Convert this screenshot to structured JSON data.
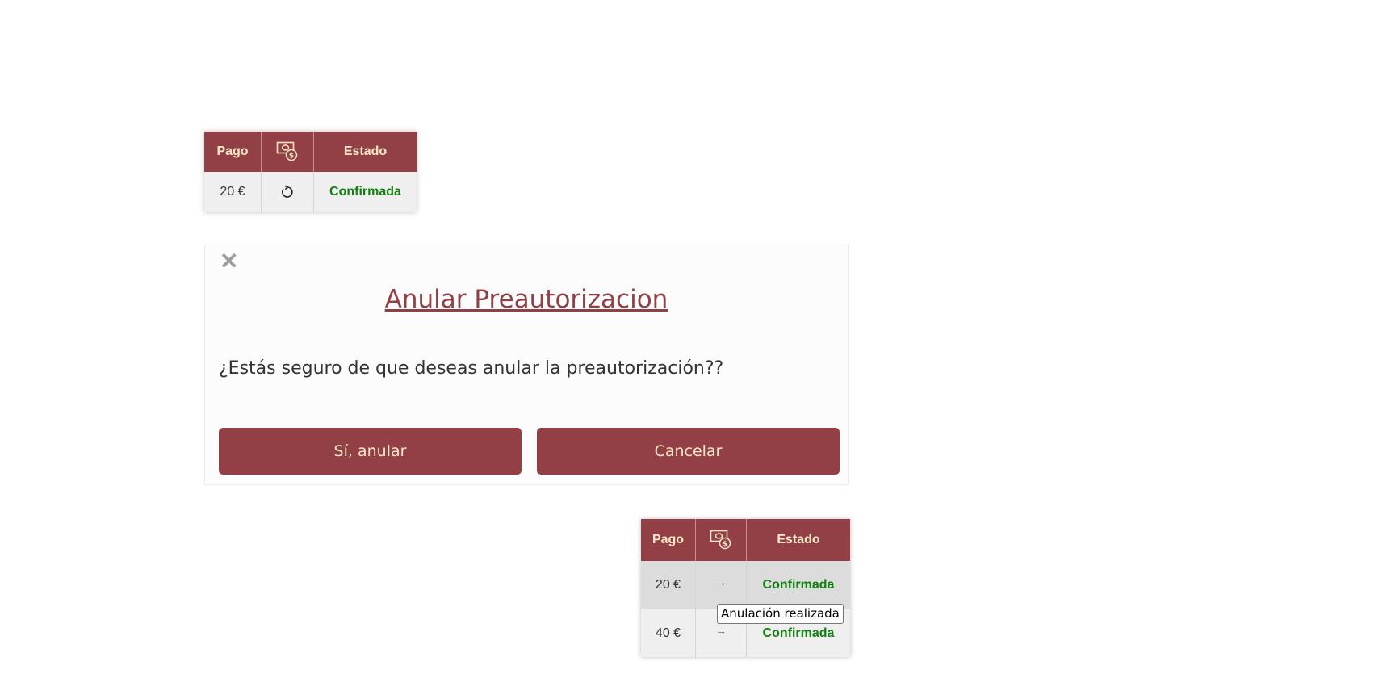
{
  "top_table": {
    "headers": {
      "pago": "Pago",
      "icon": "cash-refund-icon",
      "estado": "Estado"
    },
    "rows": [
      {
        "pago": "20 €",
        "action_icon": "reload-icon",
        "estado": "Confirmada"
      }
    ]
  },
  "dialog": {
    "close_label": "✕",
    "title": "Anular Preautorizacion",
    "message": "¿Estás seguro de que deseas anular la preautorización??",
    "confirm_label": "Sí, anular",
    "cancel_label": "Cancelar"
  },
  "bottom_table": {
    "headers": {
      "pago": "Pago",
      "icon": "cash-refund-icon",
      "estado": "Estado"
    },
    "rows": [
      {
        "pago": "20 €",
        "action_glyph": "→",
        "estado": "Confirmada"
      },
      {
        "pago": "40 €",
        "action_glyph": "→",
        "estado": "Confirmada"
      }
    ]
  },
  "tooltip": {
    "text": "Anulación realizada"
  },
  "colors": {
    "accent": "#933f46",
    "header_text": "#fde9c8",
    "status_ok": "#108010"
  }
}
